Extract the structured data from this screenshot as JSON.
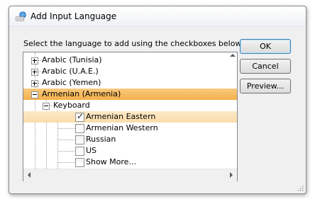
{
  "window": {
    "title": "Add Input Language"
  },
  "prompt": "Select the language to add using the checkboxes below.",
  "tree": {
    "languages": [
      {
        "label": "Arabic (Tunisia)",
        "state": "collapsed"
      },
      {
        "label": "Arabic (U.A.E.)",
        "state": "collapsed"
      },
      {
        "label": "Arabic (Yemen)",
        "state": "collapsed"
      },
      {
        "label": "Armenian (Armenia)",
        "state": "expanded",
        "selected": true
      }
    ],
    "keyboard_group": "Keyboard",
    "keyboards": [
      {
        "label": "Armenian Eastern",
        "checked": true,
        "highlighted": true
      },
      {
        "label": "Armenian Western",
        "checked": false
      },
      {
        "label": "Russian",
        "checked": false
      },
      {
        "label": "US",
        "checked": false
      },
      {
        "label": "Show More...",
        "checked": false
      }
    ]
  },
  "buttons": {
    "ok": "OK",
    "cancel": "Cancel",
    "preview": "Preview..."
  },
  "colors": {
    "selection_strong": "#f5b04a",
    "selection_light": "#fbdcaa",
    "dialog_bg": "#f0f0f0"
  }
}
